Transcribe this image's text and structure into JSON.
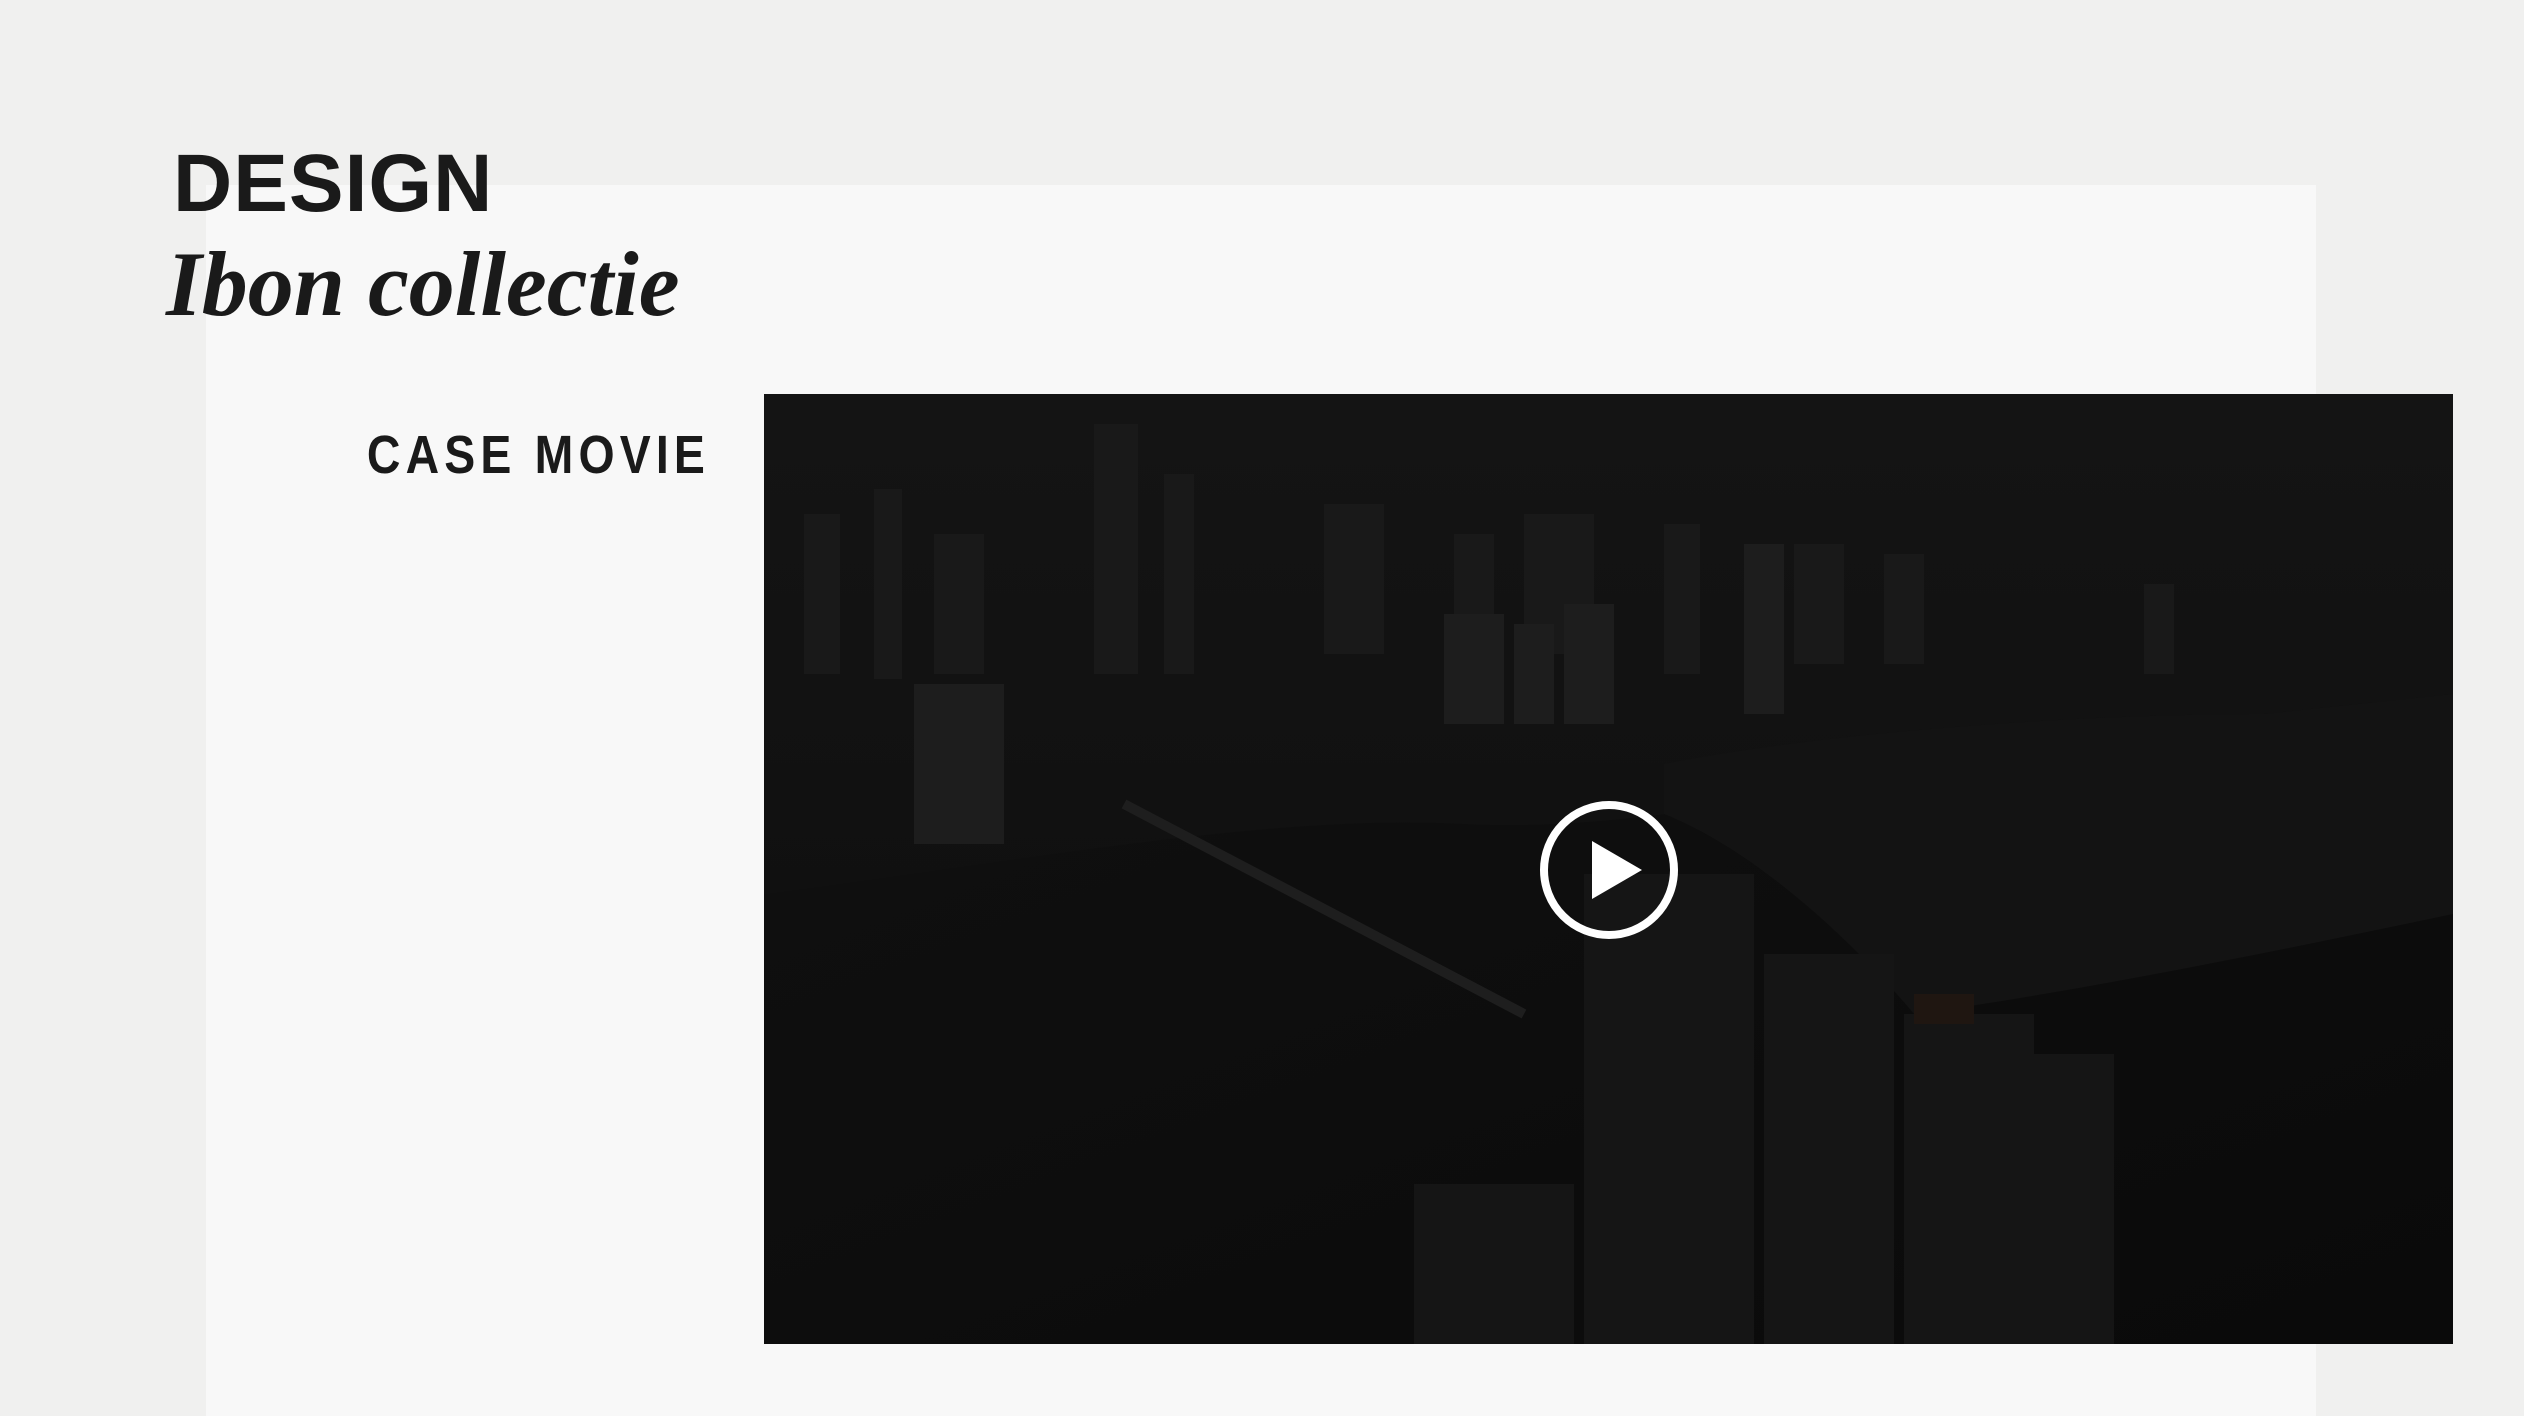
{
  "header": {
    "category": "DESIGN",
    "title": "Ibon collectie"
  },
  "section": {
    "label": "CASE MOVIE"
  },
  "video": {
    "play_icon": "play-icon"
  },
  "colors": {
    "page_background": "#f0f0ef",
    "panel_background": "#f8f8f8",
    "text": "#1a1a1a",
    "video_background": "#0c0c0c",
    "play_icon": "#ffffff"
  }
}
